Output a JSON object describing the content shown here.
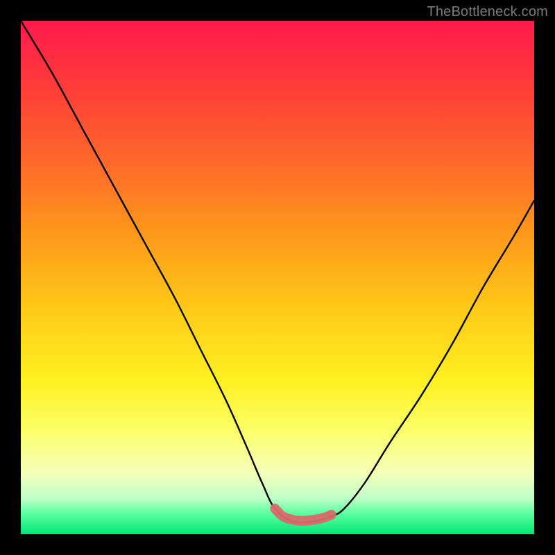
{
  "attribution": "TheBottleneck.com",
  "chart_data": {
    "type": "line",
    "title": "",
    "xlabel": "",
    "ylabel": "",
    "xlim": [
      0,
      100
    ],
    "ylim": [
      0,
      100
    ],
    "series": [
      {
        "name": "curve",
        "x": [
          0,
          6,
          12,
          18,
          24,
          30,
          35,
          40,
          44,
          47,
          49.5,
          53,
          57,
          60.5,
          63,
          67,
          72,
          78,
          84,
          90,
          96,
          100
        ],
        "values": [
          100,
          90,
          79,
          68,
          57,
          46,
          36,
          26,
          17,
          10,
          5,
          2.5,
          2.5,
          3.5,
          5,
          10,
          18,
          27,
          37,
          48,
          58,
          65
        ]
      },
      {
        "name": "marker-band",
        "x": [
          49.5,
          51,
          53,
          55,
          57,
          59,
          60.5
        ],
        "values": [
          5,
          3.5,
          2.8,
          2.6,
          2.8,
          3.2,
          3.8
        ]
      }
    ],
    "colors": {
      "curve": "#000000",
      "marker_band": "#d96a6a"
    }
  }
}
